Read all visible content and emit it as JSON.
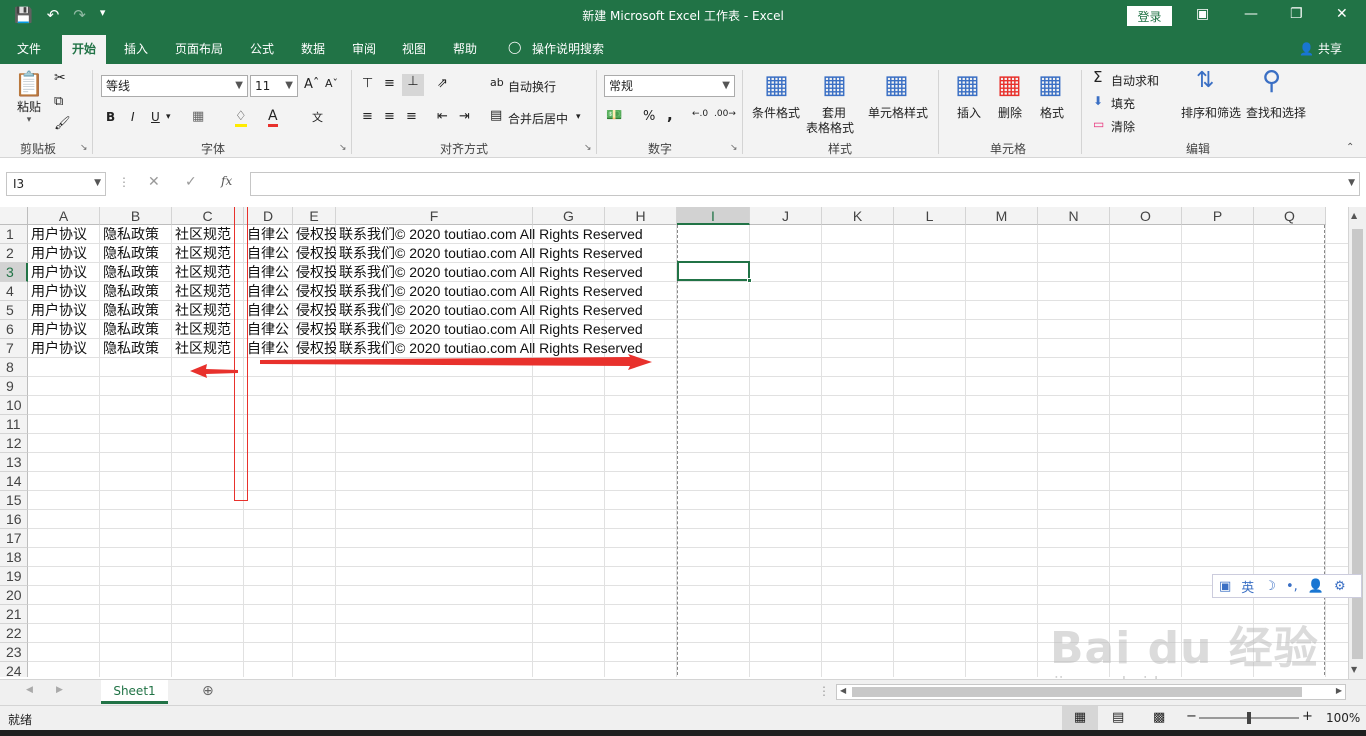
{
  "window": {
    "title": "新建 Microsoft Excel 工作表  -  Excel",
    "login": "登录"
  },
  "tabs": [
    "文件",
    "开始",
    "插入",
    "页面布局",
    "公式",
    "数据",
    "审阅",
    "视图",
    "帮助",
    "操作说明搜索"
  ],
  "share": "共享",
  "ribbon": {
    "clipboard": {
      "paste": "粘贴",
      "label": "剪贴板"
    },
    "font": {
      "name": "等线",
      "size": "11",
      "bold": "B",
      "italic": "I",
      "underline": "U",
      "label": "字体"
    },
    "alignment": {
      "wrap": "自动换行",
      "merge": "合并后居中",
      "label": "对齐方式"
    },
    "number": {
      "format": "常规",
      "percent": "%",
      "comma": ",",
      "label": "数字"
    },
    "styles": {
      "conditional": "条件格式",
      "table_line1": "套用",
      "table_line2": "表格格式",
      "cell_styles": "单元格样式",
      "label": "样式"
    },
    "cells": {
      "insert": "插入",
      "delete": "删除",
      "format": "格式",
      "label": "单元格"
    },
    "editing": {
      "autosum": "自动求和",
      "fill": "填充",
      "clear": "清除",
      "sort": "排序和筛选",
      "find": "查找和选择",
      "label": "编辑"
    }
  },
  "formula": {
    "namebox": "I3",
    "fx": "fx",
    "value": ""
  },
  "columns": [
    "A",
    "B",
    "C",
    "D",
    "E",
    "F",
    "G",
    "H",
    "I",
    "J",
    "K",
    "L",
    "M",
    "N",
    "O",
    "P",
    "Q"
  ],
  "rows": [
    "1",
    "2",
    "3",
    "4",
    "5",
    "6",
    "7",
    "8",
    "9",
    "10",
    "11",
    "12",
    "13",
    "14",
    "15",
    "16",
    "17",
    "18",
    "19",
    "20",
    "21",
    "22",
    "23",
    "24"
  ],
  "row_cells": {
    "A": "用户协议",
    "B": "隐私政策",
    "C": "社区规范",
    "D": "自律公",
    "E": "侵权投",
    "F": "联系我们© 2020 toutiao.com All Rights Reserved"
  },
  "sheet": {
    "name": "Sheet1"
  },
  "status": {
    "ready": "就绪",
    "zoom": "100%"
  },
  "ime": {
    "lang": "英"
  },
  "watermark": {
    "brand": "Bai du 经验",
    "url": "jingyan.baidu.com"
  },
  "colors": {
    "excel_green": "#217346",
    "annotation_red": "#e8312c"
  }
}
